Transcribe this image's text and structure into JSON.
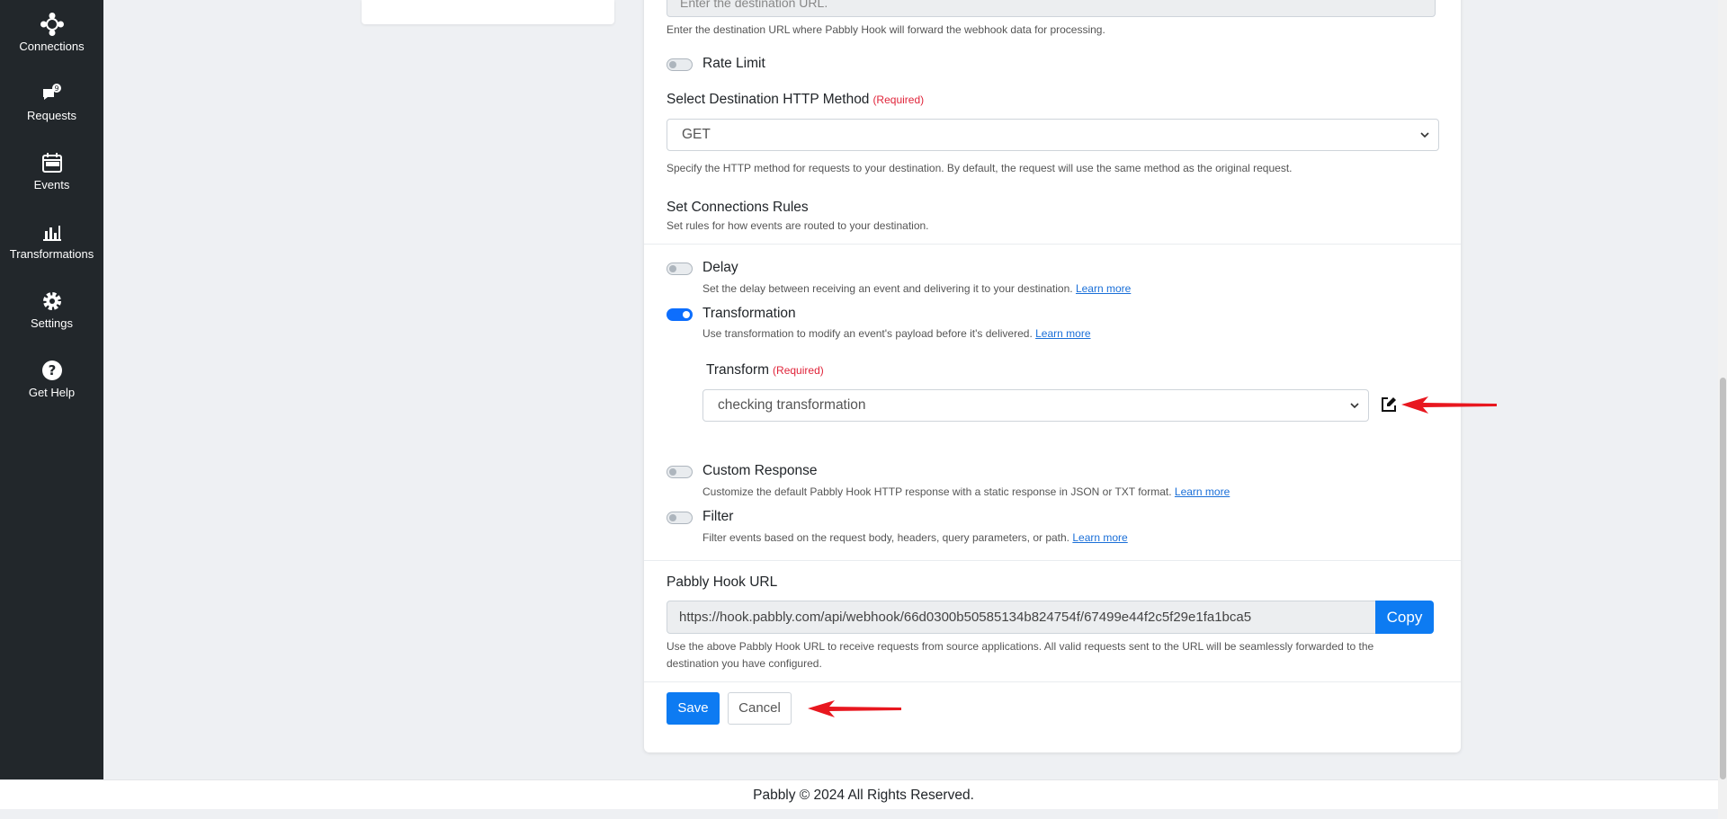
{
  "sidebar": {
    "items": [
      {
        "label": "Connections",
        "icon": "connections-icon"
      },
      {
        "label": "Requests",
        "icon": "requests-icon"
      },
      {
        "label": "Events",
        "icon": "calendar-icon"
      },
      {
        "label": "Transformations",
        "icon": "chart-icon"
      },
      {
        "label": "Settings",
        "icon": "gear-icon"
      },
      {
        "label": "Get Help",
        "icon": "help-icon"
      }
    ]
  },
  "form": {
    "destination": {
      "placeholder": "Enter the destination URL.",
      "help": "Enter the destination URL where Pabbly Hook will forward the webhook data for processing."
    },
    "rate_limit": {
      "label": "Rate Limit",
      "enabled": false
    },
    "http_method": {
      "label": "Select Destination HTTP Method",
      "required": "(Required)",
      "value": "GET",
      "help": "Specify the HTTP method for requests to your destination. By default, the request will use the same method as the original request."
    },
    "rules": {
      "title": "Set Connections Rules",
      "help": "Set rules for how events are routed to your destination."
    },
    "delay": {
      "label": "Delay",
      "enabled": false,
      "help": "Set the delay between receiving an event and delivering it to your destination.",
      "link": "Learn more"
    },
    "transformation": {
      "label": "Transformation",
      "enabled": true,
      "help": "Use transformation to modify an event's payload before it's delivered.",
      "link": "Learn more",
      "transform_label": "Transform",
      "transform_required": "(Required)",
      "transform_value": "checking transformation"
    },
    "custom_response": {
      "label": "Custom Response",
      "enabled": false,
      "help": "Customize the default Pabbly Hook HTTP response with a static response in JSON or TXT format.",
      "link": "Learn more"
    },
    "filter": {
      "label": "Filter",
      "enabled": false,
      "help": "Filter events based on the request body, headers, query parameters, or path.",
      "link": "Learn more"
    },
    "hook_url": {
      "label": "Pabbly Hook URL",
      "value": "https://hook.pabbly.com/api/webhook/66d0300b50585134b824754f/67499e44f2c5f29e1fa1bca5",
      "copy_label": "Copy",
      "help_line1": "Use the above Pabbly Hook URL to receive requests from source applications. All valid requests sent to the URL will be seamlessly forwarded to the",
      "help_line2": "destination you have configured."
    },
    "save_label": "Save",
    "cancel_label": "Cancel"
  },
  "footer": {
    "text": "Pabbly © 2024 All Rights Reserved."
  },
  "colors": {
    "sidebar_bg": "#22272b",
    "primary": "#0d7bf2",
    "required": "#e0243a",
    "annotation_arrow": "#e8171f"
  }
}
